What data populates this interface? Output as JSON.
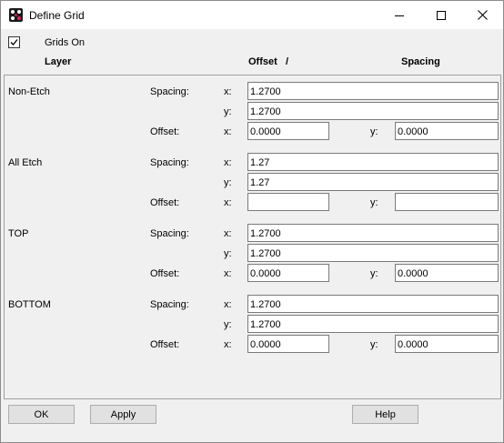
{
  "window": {
    "title": "Define Grid"
  },
  "grids_on": {
    "label": "Grids On",
    "checked": true
  },
  "headers": {
    "layer": "Layer",
    "offset": "Offset",
    "separator": "/",
    "spacing": "Spacing"
  },
  "labels": {
    "spacing": "Spacing:",
    "offset": "Offset:",
    "x": "x:",
    "y": "y:"
  },
  "layers": [
    {
      "name": "Non-Etch",
      "spacing_x": "1.2700",
      "spacing_y": "1.2700",
      "offset_x": "0.0000",
      "offset_y": "0.0000"
    },
    {
      "name": "All Etch",
      "spacing_x": "1.27",
      "spacing_y": "1.27",
      "offset_x": "",
      "offset_y": ""
    },
    {
      "name": "TOP",
      "spacing_x": "1.2700",
      "spacing_y": "1.2700",
      "offset_x": "0.0000",
      "offset_y": "0.0000"
    },
    {
      "name": "BOTTOM",
      "spacing_x": "1.2700",
      "spacing_y": "1.2700",
      "offset_x": "0.0000",
      "offset_y": "0.0000"
    }
  ],
  "buttons": {
    "ok": "OK",
    "apply": "Apply",
    "help": "Help"
  }
}
